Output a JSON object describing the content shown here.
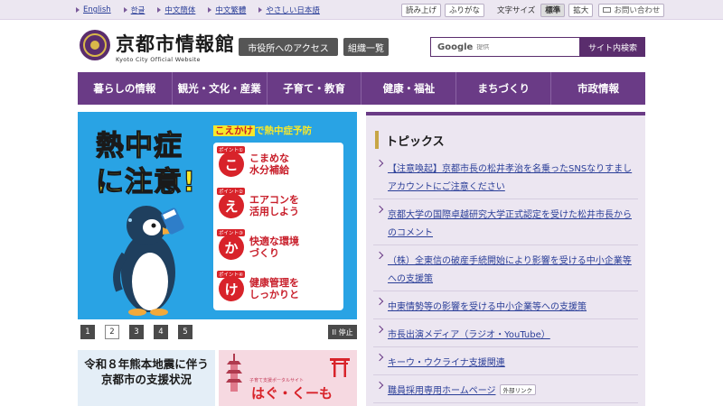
{
  "utility": {
    "languages": [
      "English",
      "한글",
      "中文簡体",
      "中文繁體",
      "やさしい日本語"
    ],
    "read_aloud": "読み上げ",
    "furigana": "ふりがな",
    "font_size_label": "文字サイズ",
    "font_standard": "標準",
    "font_large": "拡大",
    "contact": "お問い合わせ"
  },
  "header": {
    "site_title": "京都市情報館",
    "site_subtitle": "Kyoto City Official Website",
    "access_button": "市役所へのアクセス",
    "org_button": "組織一覧",
    "search_engine": "Google",
    "search_placeholder": "提供",
    "search_button": "サイト内検索"
  },
  "nav": [
    "暮らしの情報",
    "観光・文化・産業",
    "子育て・教育",
    "健康・福祉",
    "まちづくり",
    "市政情報"
  ],
  "banner": {
    "title_line1": "熱中症",
    "title_line2": "に注意!",
    "campaign_prefix": "こえかけ",
    "campaign_suffix": "で熱中症予防",
    "points": [
      {
        "tag": "ポイント①",
        "char": "こ",
        "text": "こまめな\n水分補給"
      },
      {
        "tag": "ポイント②",
        "char": "え",
        "text": "エアコンを\n活用しよう"
      },
      {
        "tag": "ポイント③",
        "char": "か",
        "text": "快適な環境\nづくり"
      },
      {
        "tag": "ポイント④",
        "char": "け",
        "text": "健康管理を\nしっかりと"
      }
    ]
  },
  "slider": {
    "pages": [
      "1",
      "2",
      "3",
      "4",
      "5"
    ],
    "active_page": "2",
    "pause_label": "II 停止"
  },
  "lower_banners": {
    "left_text": "令和８年熊本地震に伴う\n京都市の支援状況",
    "right_small": "子育て支援ポータルサイト",
    "right_big": "はぐ・くーも"
  },
  "topics": {
    "title": "トピックス",
    "external_label": "外部リンク",
    "items": [
      {
        "text": "【注意喚起】京都市長の松井孝治を名乗ったSNSなりすましアカウントにご注意ください",
        "external": false
      },
      {
        "text": "京都大学の国際卓越研究大学正式認定を受けた松井市長からのコメント",
        "external": false
      },
      {
        "text": "（株）全東信の破産手続開始により影響を受ける中小企業等への支援策",
        "external": false
      },
      {
        "text": "中東情勢等の影響を受ける中小企業等への支援策",
        "external": false
      },
      {
        "text": "市長出演メディア（ラジオ・YouTube）",
        "external": false
      },
      {
        "text": "キーウ・ウクライナ支援関連",
        "external": false
      },
      {
        "text": "職員採用専用ホームページ",
        "external": true
      }
    ]
  },
  "colors": {
    "brand_purple": "#6a3b86",
    "banner_blue": "#29a3e4",
    "banner_yellow": "#f7e82a",
    "accent_red": "#d8232a",
    "link_blue": "#2a3e98"
  }
}
